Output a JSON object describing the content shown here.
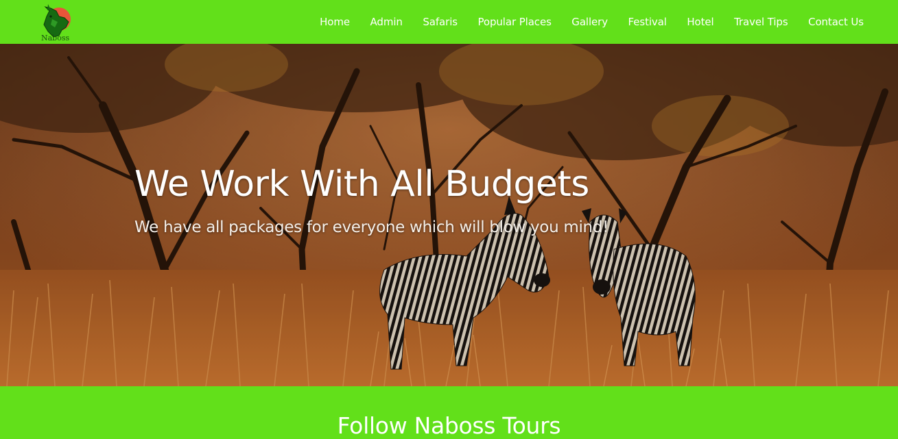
{
  "brand": {
    "name": "Naboss",
    "logo_icon": "rhino-logo-icon"
  },
  "nav": {
    "items": [
      {
        "label": "Home"
      },
      {
        "label": "Admin"
      },
      {
        "label": "Safaris"
      },
      {
        "label": "Popular Places"
      },
      {
        "label": "Gallery"
      },
      {
        "label": "Festival"
      },
      {
        "label": "Hotel"
      },
      {
        "label": "Travel Tips"
      },
      {
        "label": "Contact Us"
      }
    ]
  },
  "hero": {
    "title": "We Work With All Budgets",
    "subtitle": "We have all packages for everyone which will blow you mind!",
    "image_subject": "zebras-in-savanna"
  },
  "follow": {
    "title": "Follow Naboss Tours"
  },
  "colors": {
    "brand_green": "#62e01a",
    "nav_text": "#ffffff",
    "hero_text": "#ffffff"
  }
}
